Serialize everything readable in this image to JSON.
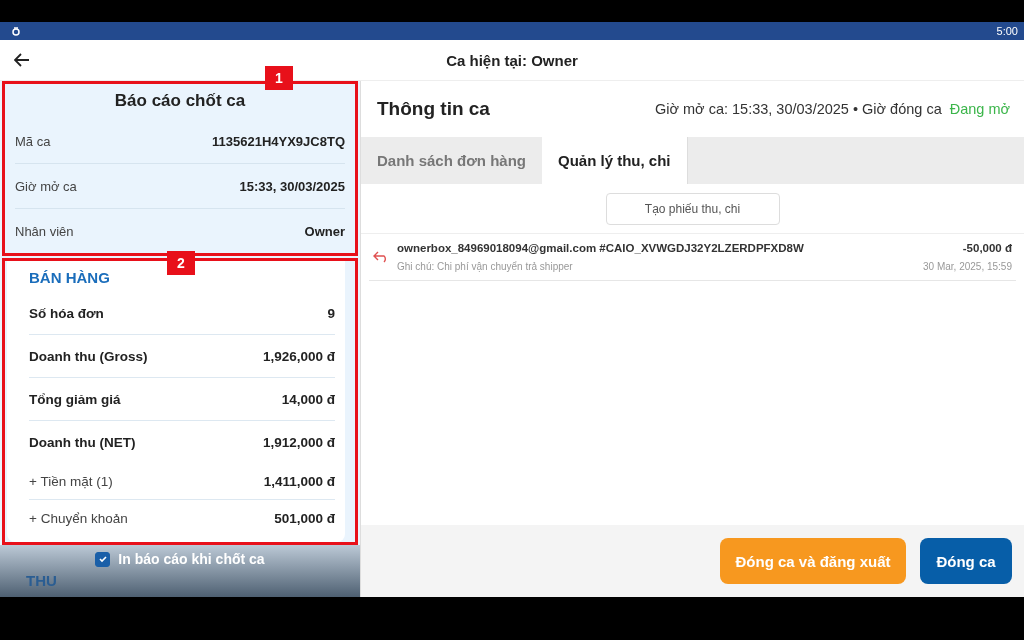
{
  "status_bar": {
    "time": "5:00"
  },
  "header": {
    "title": "Ca hiện tại: Owner"
  },
  "report": {
    "title": "Báo cáo chốt ca",
    "annotation": "1",
    "rows": [
      {
        "label": "Mã ca",
        "value": "1135621H4YX9JC8TQ"
      },
      {
        "label": "Giờ mở ca",
        "value": "15:33, 30/03/2025"
      },
      {
        "label": "Nhân viên",
        "value": "Owner"
      }
    ]
  },
  "sales": {
    "title": "BÁN HÀNG",
    "annotation": "2",
    "rows": [
      {
        "kind": "main",
        "label": "Số hóa đơn",
        "value": "9"
      },
      {
        "kind": "main",
        "label": "Doanh thu (Gross)",
        "value": "1,926,000 đ"
      },
      {
        "kind": "main",
        "label": "Tổng giảm giá",
        "value": "14,000 đ"
      },
      {
        "kind": "main",
        "label": "Doanh thu (NET)",
        "value": "1,912,000 đ"
      },
      {
        "kind": "sub",
        "label": "+ Tiền mặt (1)",
        "value": "1,411,000 đ"
      },
      {
        "kind": "sub",
        "label": "+ Chuyển khoản",
        "value": "501,000 đ"
      }
    ]
  },
  "print_option": {
    "label": "In báo cáo khi chốt ca",
    "checked": true
  },
  "next_section": {
    "title": "THU"
  },
  "shift_info": {
    "title": "Thông tin ca",
    "open_time": "Giờ mở ca: 15:33, 30/03/2025 • Giờ đóng ca",
    "status": "Đang mở"
  },
  "tabs": [
    {
      "label": "Danh sách đơn hàng",
      "selected": false
    },
    {
      "label": "Quản lý thu, chi",
      "selected": true
    }
  ],
  "create_button": "Tạo phiếu thu, chi",
  "transactions": [
    {
      "title": "ownerbox_84969018094@gmail.com #CAIO_XVWGDJ32Y2LZERDPFXD8W",
      "amount": "-50,000 đ",
      "note": "Ghi chú: Chi phí vận chuyển trả shipper",
      "time": "30 Mar, 2025, 15:59"
    }
  ],
  "actions": [
    {
      "label": "Đóng ca và đăng xuất",
      "kind": "secondary"
    },
    {
      "label": "Đóng ca",
      "kind": "primary"
    }
  ]
}
